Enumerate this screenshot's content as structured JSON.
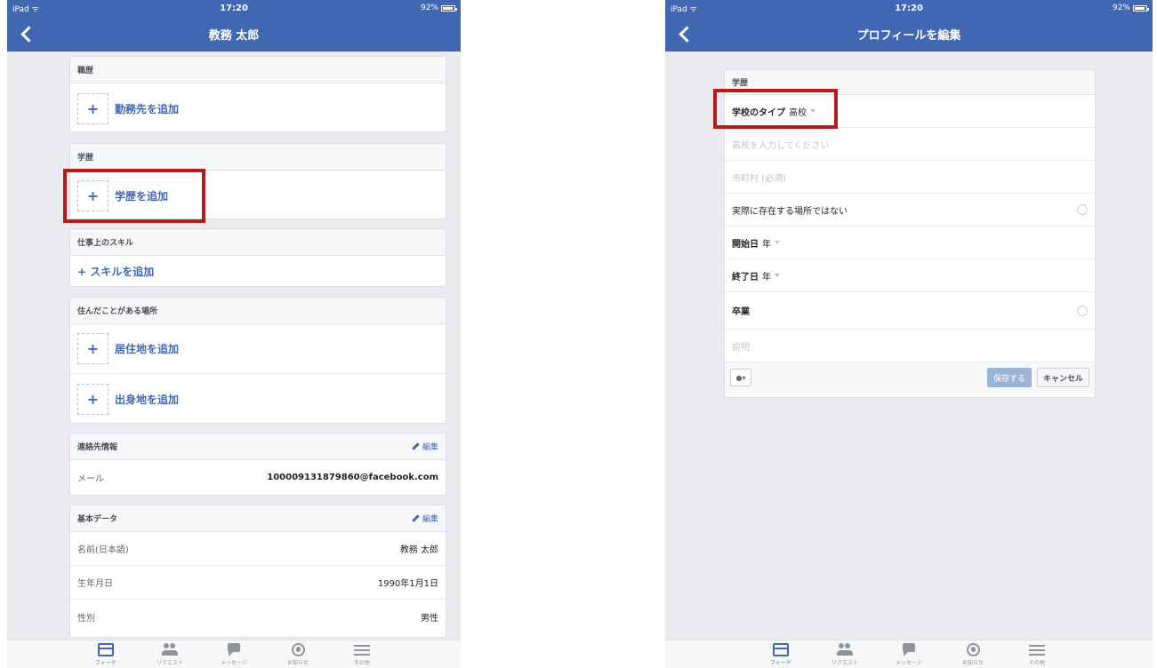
{
  "left": {
    "status": {
      "device": "iPad ᯤ",
      "time": "17:20",
      "battery": "92%"
    },
    "nav_title": "教務 太郎",
    "sections": {
      "work": {
        "header": "職歴",
        "add": "勤務先を追加"
      },
      "education": {
        "header": "学歴",
        "add": "学歴を追加"
      },
      "skills": {
        "header": "仕事上のスキル",
        "add": "+ スキルを追加"
      },
      "places": {
        "header": "住んだことがある場所",
        "add_current": "居住地を追加",
        "add_hometown": "出身地を追加"
      },
      "contact": {
        "header": "連絡先情報",
        "edit": "編集",
        "email_label": "メール",
        "email_value": "100009131879860@facebook.com"
      },
      "basic": {
        "header": "基本データ",
        "edit": "編集",
        "rows": [
          {
            "label": "名前(日本語)",
            "value": "教務 太郎"
          },
          {
            "label": "生年月日",
            "value": "1990年1月1日"
          },
          {
            "label": "性別",
            "value": "男性"
          }
        ]
      }
    },
    "plus": "+"
  },
  "right": {
    "status": {
      "device": "iPad ᯤ",
      "time": "17:20",
      "battery": "92%"
    },
    "nav_title": "プロフィールを編集",
    "form": {
      "header": "学歴",
      "school_type_label": "学校のタイプ",
      "school_type_value": "高校",
      "school_placeholder": "高校を入力してください",
      "city_placeholder": "市町村 (必須)",
      "not_real_place": "実際に存在する場所ではない",
      "start_label": "開始日",
      "start_value": "年",
      "end_label": "終了日",
      "end_value": "年",
      "graduated": "卒業",
      "description_placeholder": "説明",
      "privacy": "●▾",
      "save": "保存する",
      "cancel": "キャンセル"
    }
  },
  "tabs": [
    "フィード",
    "リクエスト",
    "メッセージ",
    "お知らせ",
    "その他"
  ],
  "colors": {
    "brand": "#4267b2",
    "highlight": "#b41c1c"
  }
}
